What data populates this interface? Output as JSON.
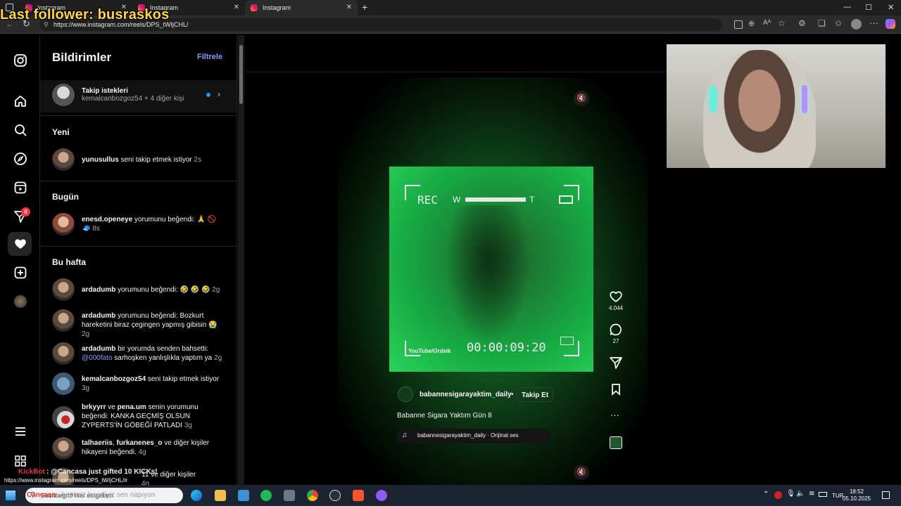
{
  "overlay": {
    "stream_title": "Last follower: busraskos"
  },
  "browser": {
    "tabs": [
      {
        "label": "Instagram"
      },
      {
        "label": "Instagram"
      },
      {
        "label": "Instagram"
      }
    ],
    "new_tab": "+",
    "url": "https://www.instagram.com/reels/DPS_tWIjCHL/",
    "window_controls": {
      "minimize": "—",
      "maximize": "☐",
      "close": "✕"
    }
  },
  "nav": {
    "items": [
      "instagram-logo",
      "home",
      "search",
      "explore",
      "reels",
      "messages",
      "notifications",
      "create",
      "profile",
      "more",
      "apps"
    ],
    "messages_badge": "8"
  },
  "notifications": {
    "title": "Bildirimler",
    "filter": "Filtrele",
    "follow_requests": {
      "title": "Takip istekleri",
      "subtitle": "kemalcanbozgoz54 + 4 diğer kişi"
    },
    "sections": {
      "new": "Yeni",
      "today": "Bugün",
      "this_week": "Bu hafta"
    },
    "new_items": [
      {
        "user": "yunusullus",
        "text": " seni takip etmek istiyor ",
        "time": "2s"
      }
    ],
    "today_items": [
      {
        "user": "enesd.openeye",
        "text": " yorumunu beğendi: 🙏 🚫",
        "line2": "🧢 ",
        "time": "8s"
      }
    ],
    "week_items": [
      {
        "user": "ardadumb",
        "text": " yorumunu beğendi: 🤣 🤣 🤣 ",
        "time": "2g"
      },
      {
        "user": "ardadumb",
        "text": " yorumunu beğendi: Bozkurt hareketini biraz çegingen yapmış gibisin 😭",
        "time": "2g"
      },
      {
        "user": "ardadumb",
        "text": " bir yorumda senden bahsetti: ",
        "mention": "@000fato",
        "text2": " sarhoşken yanlışlıkla yaptım ya ",
        "time": "2g"
      },
      {
        "user": "kemalcanbozgoz54",
        "text": " seni takip etmek istiyor",
        "time": "3g"
      },
      {
        "user": "brkyyrr",
        "text": " ve ",
        "user2": "pena.um",
        "text2": " senin yorumunu beğendi: KANKA GEÇMİŞ OLSUN ZYPERTS'İN GÖBEĞİ PATLADI ",
        "time": "3g"
      },
      {
        "user": "talhaeriis",
        "text": ", ",
        "user2": "furkanenes_o",
        "text2": " ve diğer kişiler hikayeni beğendi. ",
        "time": "4g"
      },
      {
        "user": "",
        "text": "11 ve diğer kişiler",
        "time": "4g"
      }
    ]
  },
  "reel": {
    "video_overlay": {
      "rec": "REC",
      "zoom_w": "W",
      "zoom_t": "T",
      "timecode": "00:00:09:20",
      "watermark": "YouTube/Ordeik"
    },
    "likes": "4.044",
    "comments": "27",
    "more": "···",
    "author": "babannesigarayaktim_daily",
    "dot": "•",
    "follow": "Takip Et",
    "caption": "Babanne Sigara Yaktım Gün 8",
    "audio": "babannesigarayaktim_daily · Orijinal ses",
    "mute_icon": "🔇"
  },
  "stream_chat": {
    "kickbot": "KickBot",
    "message": ": @Cancasa just gifted 10 KICKs!",
    "status_url": "https://www.instagram.com/reels/DPS_tWIjCHL/#",
    "line3_user": "Cancasa",
    "line3_text": ": hepimiz lanetliyiz sen napıyon"
  },
  "taskbar": {
    "search_placeholder": "Suchbegriff hier eingeben",
    "lang": "TUR",
    "time": "18:52",
    "date": "05.10.2025"
  }
}
